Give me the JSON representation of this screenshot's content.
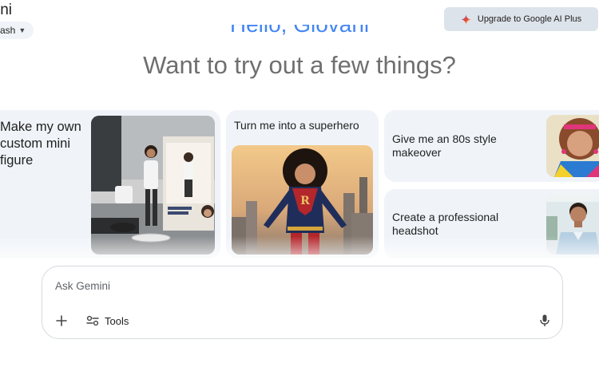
{
  "header": {
    "app_title": "ini",
    "model_label": "ash",
    "upgrade_label": "Upgrade to Google AI Plus"
  },
  "greeting": {
    "hello": "Hello, Giovani",
    "prompt": "Want to try out a few things?"
  },
  "suggestions": [
    {
      "label": "Make my own custom mini figure"
    },
    {
      "label": "Turn me into a superhero"
    },
    {
      "label": "Give me an 80s style makeover"
    },
    {
      "label": "Create a professional headshot"
    }
  ],
  "composer": {
    "placeholder": "Ask Gemini",
    "tools_label": "Tools"
  },
  "colors": {
    "accent_blue": "#4285f4",
    "card_bg": "#f0f4f9",
    "upgrade_bg": "#dde3ea"
  },
  "icons": {
    "sparkle": "sparkle-icon",
    "chevron": "chevron-down-icon",
    "plus": "plus-icon",
    "tools": "tools-icon",
    "mic": "microphone-icon"
  }
}
